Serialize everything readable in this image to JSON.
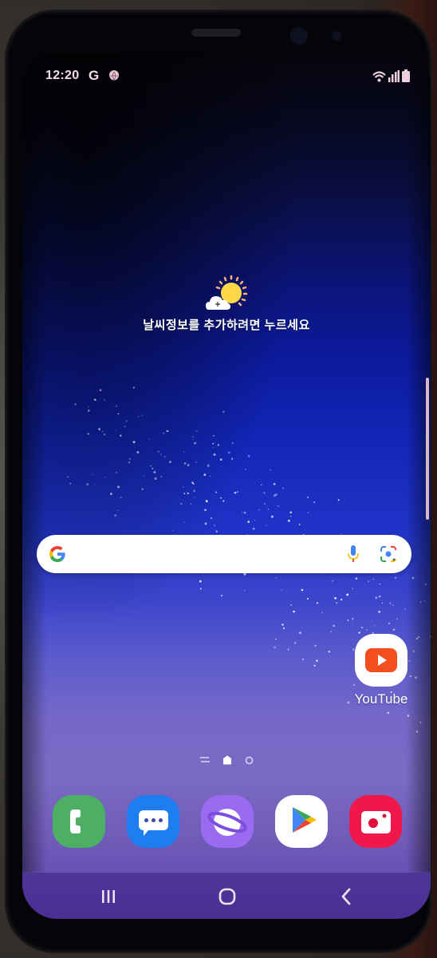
{
  "status_bar": {
    "time": "12:20",
    "notification_g": "G",
    "icons": [
      "google-icon",
      "globe-icon",
      "wifi-icon",
      "signal-icon",
      "battery-icon"
    ]
  },
  "weather_widget": {
    "icon": "sun-cloud-add-icon",
    "prompt": "날씨정보를 추가하려면 누르세요"
  },
  "search_widget": {
    "icons": [
      "google-g-icon",
      "microphone-icon",
      "google-lens-icon"
    ],
    "placeholder": ""
  },
  "home_apps": [
    {
      "label": "YouTube",
      "icon": "youtube-icon",
      "color": "#f24e1e"
    }
  ],
  "page_indicator": {
    "items": [
      "list-page",
      "home-page",
      "page-2"
    ],
    "current": "home-page"
  },
  "dock": [
    {
      "name": "Phone",
      "icon": "phone-icon",
      "color": "#4caf64"
    },
    {
      "name": "Messages",
      "icon": "messages-icon",
      "color": "#1e7ef0"
    },
    {
      "name": "Samsung Internet",
      "icon": "internet-planet-icon",
      "color": "#9a6af0"
    },
    {
      "name": "Play Store",
      "icon": "play-store-icon",
      "color": "#ffffff"
    },
    {
      "name": "Screen Recorder",
      "icon": "camera-icon",
      "color": "#f0174a"
    }
  ],
  "nav_bar": {
    "buttons": [
      "recents",
      "home",
      "back"
    ]
  },
  "colors": {
    "status_text": "#f5dde6",
    "nav_bar": "#4a2f94",
    "edge_handle": "#d8b8c8"
  }
}
